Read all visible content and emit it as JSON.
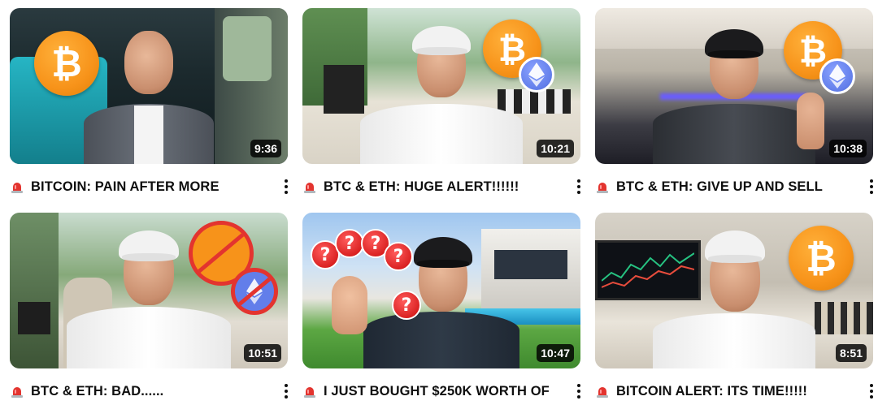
{
  "videos": [
    {
      "title": "BITCOIN: PAIN AFTER MORE",
      "duration": "9:36",
      "overlay": [
        "bitcoin-coin"
      ]
    },
    {
      "title": "BTC & ETH: HUGE ALERT!!!!!!",
      "duration": "10:21",
      "overlay": [
        "bitcoin-coin",
        "ethereum-coin"
      ]
    },
    {
      "title": "BTC & ETH: GIVE UP AND SELL",
      "duration": "10:38",
      "overlay": [
        "bitcoin-coin",
        "ethereum-coin"
      ]
    },
    {
      "title": "BTC & ETH: BAD......",
      "duration": "10:51",
      "overlay": [
        "bitcoin-banned",
        "ethereum-banned"
      ]
    },
    {
      "title": "I JUST BOUGHT $250K WORTH OF",
      "duration": "10:47",
      "overlay": [
        "question-marks"
      ]
    },
    {
      "title": "BITCOIN ALERT: ITS TIME!!!!!",
      "duration": "8:51",
      "overlay": [
        "bitcoin-coin"
      ]
    }
  ],
  "icons": {
    "title_prefix": "siren-icon",
    "menu": "more-vert-icon",
    "btc_symbol": "₿",
    "question_symbol": "?"
  },
  "colors": {
    "bitcoin": "#f7931a",
    "ethereum": "#627eea",
    "siren": "#e3342f",
    "ban": "#e3342f"
  }
}
